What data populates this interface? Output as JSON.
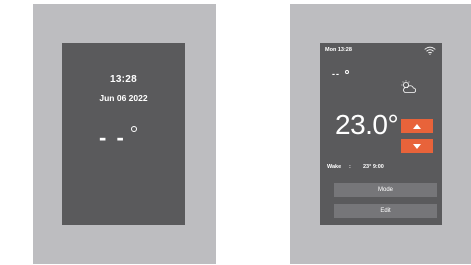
{
  "left_display": {
    "time": "13:28",
    "date": "Jun 06 2022",
    "temperature": "- -"
  },
  "right_display": {
    "status_time": "Mon 13:28",
    "outdoor_temperature": "--",
    "setpoint": "23.0°",
    "schedule": {
      "label": "Wake",
      "separator": ":",
      "temperature": "23°",
      "time": "9:00"
    },
    "buttons": {
      "mode": "Mode",
      "edit": "Edit"
    },
    "icons": {
      "wifi": "wifi-icon",
      "weather": "partly-cloudy-icon",
      "increase": "arrow-up-icon",
      "decrease": "arrow-down-icon"
    },
    "colors": {
      "accent": "#e8633a",
      "screen": "#5a5a5c",
      "button": "#767679",
      "frame": "#bdbdc0"
    }
  }
}
